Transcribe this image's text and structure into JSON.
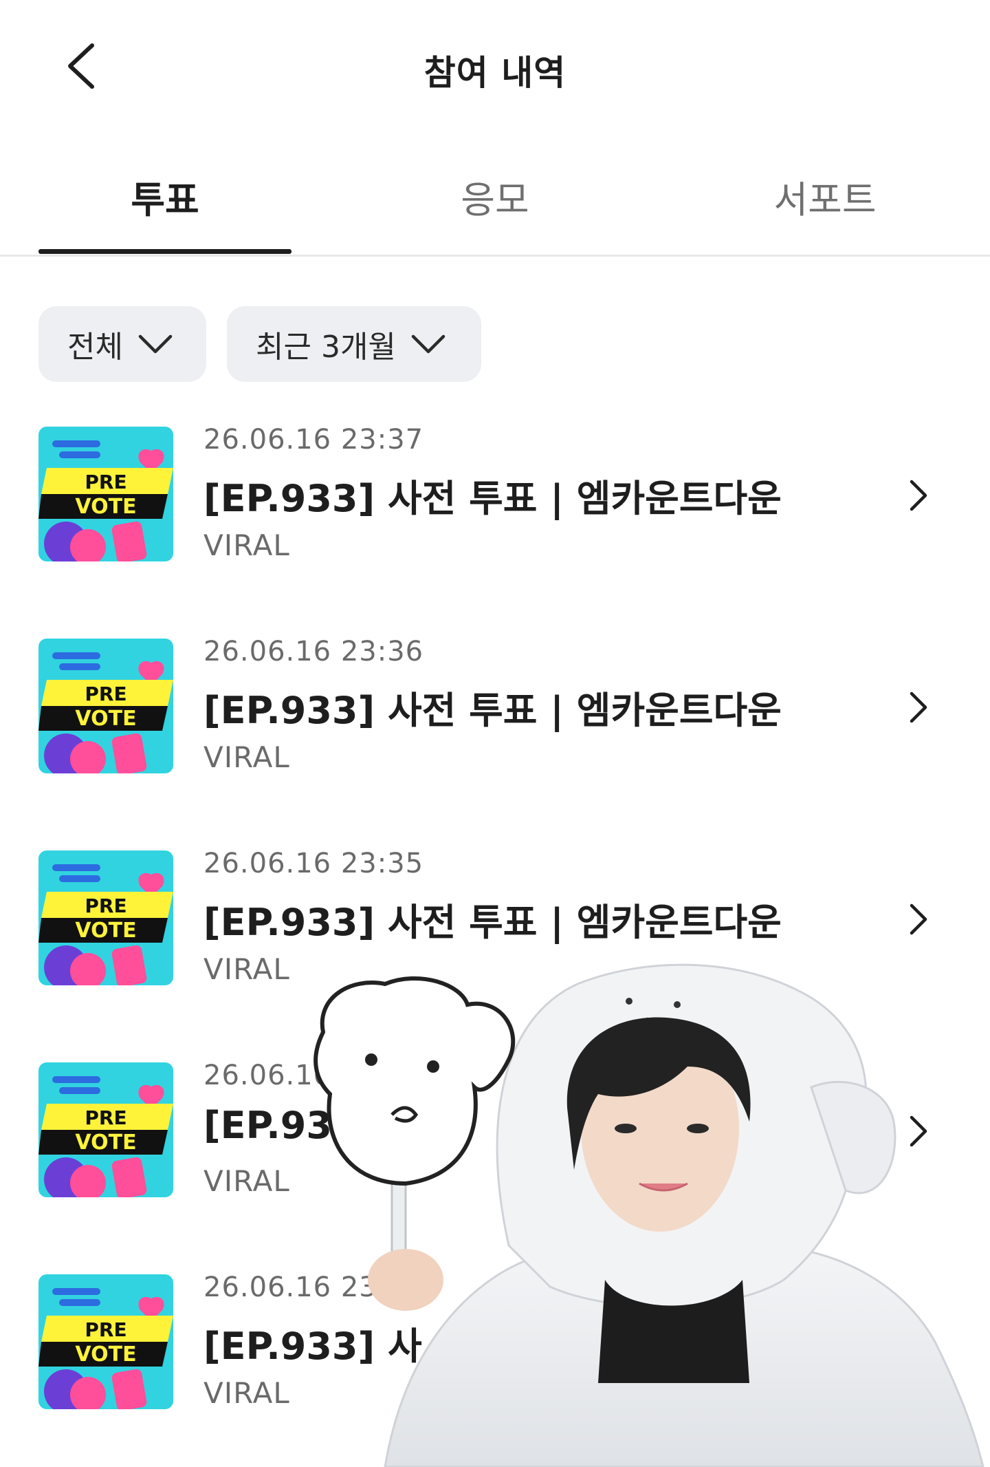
{
  "header": {
    "title": "참여 내역",
    "back_icon": "chevron-left-icon"
  },
  "tabs": [
    {
      "label": "투표",
      "active": true
    },
    {
      "label": "응모",
      "active": false
    },
    {
      "label": "서포트",
      "active": false
    }
  ],
  "filters": [
    {
      "label": "전체",
      "icon": "chevron-down-icon"
    },
    {
      "label": "최근 3개월",
      "icon": "chevron-down-icon"
    }
  ],
  "thumbnail": {
    "line1": "PRE",
    "line2": "VOTE",
    "colors": {
      "background": "#31d3e0",
      "banner_yellow": "#fff33a",
      "banner_black": "#111111",
      "pink": "#ff4e9a",
      "purple": "#6b3fd6"
    }
  },
  "items": [
    {
      "date": "26.06.16 23:37",
      "title": "[EP.933] 사전 투표 | 엠카운트다운",
      "sub": "VIRAL"
    },
    {
      "date": "26.06.16 23:36",
      "title": "[EP.933] 사전 투표 | 엠카운트다운",
      "sub": "VIRAL"
    },
    {
      "date": "26.06.16 23:35",
      "title": "[EP.933] 사전 투표 | 엠카운트다운",
      "sub": "VIRAL"
    },
    {
      "date": "26.06.16 23:35",
      "title": "[EP.93",
      "sub": "VIRAL"
    },
    {
      "date": "26.06.16 23:34",
      "title": "[EP.933] 사",
      "sub": "VIRAL"
    }
  ],
  "colors": {
    "text_primary": "#1e1e1e",
    "text_secondary": "#6a6a6a",
    "chip_bg": "#eeeff2",
    "divider": "#e8e8e8"
  }
}
